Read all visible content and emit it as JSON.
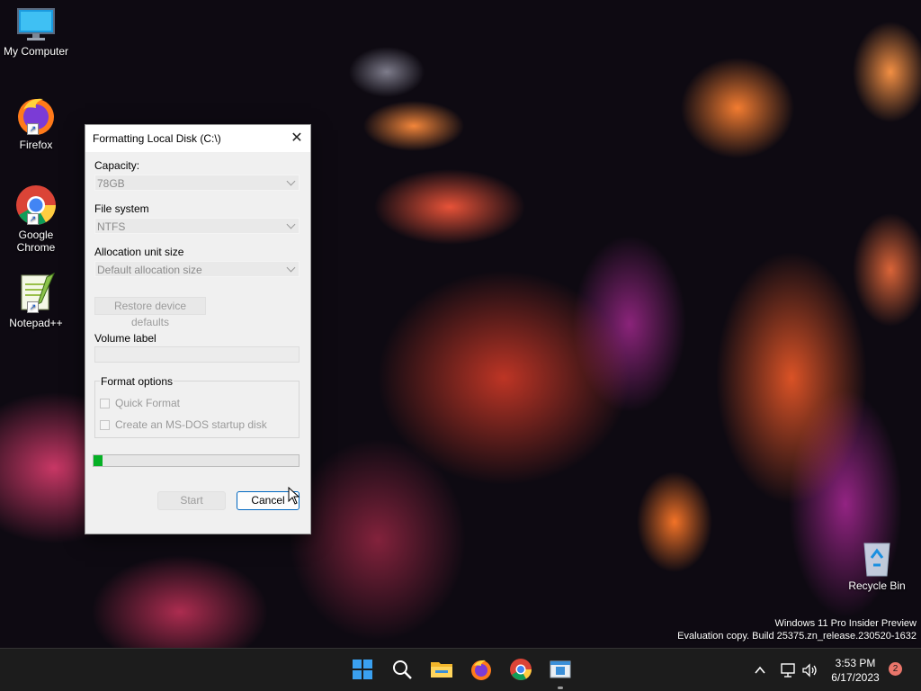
{
  "desktop": {
    "icons": [
      {
        "label": "My Computer",
        "icon": "monitor-icon"
      },
      {
        "label": "Firefox",
        "icon": "firefox-icon"
      },
      {
        "label": "Google Chrome",
        "icon": "chrome-icon"
      },
      {
        "label": "Notepad++",
        "icon": "notepadpp-icon"
      },
      {
        "label": "Recycle Bin",
        "icon": "recycle-bin-icon"
      }
    ],
    "watermark": {
      "line1": "Windows 11 Pro Insider Preview",
      "line2": "Evaluation copy. Build 25375.zn_release.230520-1632"
    }
  },
  "dialog": {
    "title": "Formatting Local Disk (C:\\)",
    "close_glyph": "✕",
    "capacity": {
      "label": "Capacity:",
      "value": "78GB"
    },
    "file_system": {
      "label": "File system",
      "value": "NTFS"
    },
    "allocation": {
      "label": "Allocation unit size",
      "value": "Default allocation size"
    },
    "restore_button": "Restore device defaults",
    "volume_label": {
      "label": "Volume label",
      "value": ""
    },
    "format_options": {
      "title": "Format options",
      "quick_format": {
        "label": "Quick Format",
        "checked": false,
        "enabled": false
      },
      "msdos_disk": {
        "label": "Create an MS-DOS startup disk",
        "checked": false,
        "enabled": false
      }
    },
    "progress": {
      "fraction": 0.045,
      "color": "#06b025"
    },
    "start_button": "Start",
    "cancel_button": "Cancel"
  },
  "taskbar": {
    "apps": [
      "start-icon",
      "search-icon",
      "file-explorer-icon",
      "firefox-icon",
      "chrome-icon",
      "format-dialog-app-icon"
    ],
    "clock": {
      "time": "3:53 PM",
      "date": "6/17/2023"
    },
    "notification_count": "2"
  }
}
